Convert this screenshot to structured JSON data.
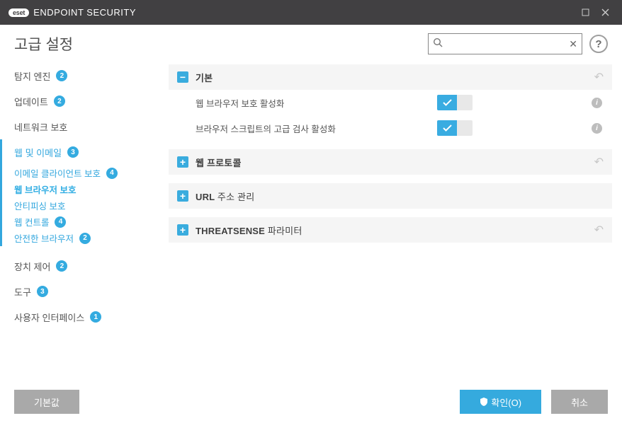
{
  "app": {
    "logo": "eset",
    "title": "ENDPOINT SECURITY"
  },
  "page": {
    "title": "고급 설정"
  },
  "search": {
    "placeholder": ""
  },
  "sidebar": {
    "items": [
      {
        "label": "탐지 엔진",
        "badge": "2"
      },
      {
        "label": "업데이트",
        "badge": "2"
      },
      {
        "label": "네트워크 보호",
        "badge": ""
      },
      {
        "label": "웹 및 이메일",
        "badge": "3"
      }
    ],
    "sub": [
      {
        "label": "이메일 클라이언트 보호",
        "badge": "4"
      },
      {
        "label": "웹 브라우저 보호",
        "badge": ""
      },
      {
        "label": "안티피싱 보호",
        "badge": ""
      },
      {
        "label": "웹 컨트롤",
        "badge": "4"
      },
      {
        "label": "안전한 브라우저",
        "badge": "2"
      }
    ],
    "items2": [
      {
        "label": "장치 제어",
        "badge": "2"
      },
      {
        "label": "도구",
        "badge": "3"
      },
      {
        "label": "사용자 인터페이스",
        "badge": "1"
      }
    ]
  },
  "sections": {
    "basic": {
      "title": "기본",
      "row1": "웹 브라우저 보호 활성화",
      "row2": "브라우저 스크립트의 고급 검사 활성화"
    },
    "protocols": {
      "title": "웹 프로토콜"
    },
    "url": {
      "title_prefix": "URL ",
      "title_suffix": "주소 관리"
    },
    "threat": {
      "title_prefix": "THREATSENSE ",
      "title_suffix": "파라미터"
    }
  },
  "footer": {
    "default": "기본값",
    "ok": "확인(O)",
    "cancel": "취소"
  }
}
